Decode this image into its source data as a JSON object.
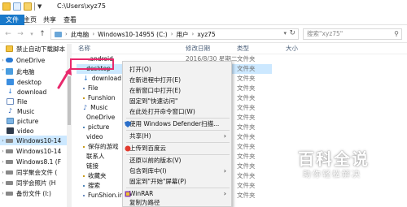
{
  "window": {
    "title": "C:\\Users\\xyz75"
  },
  "ribbon": {
    "tabs": [
      "文件",
      "主页",
      "共享",
      "查看"
    ]
  },
  "address": {
    "segments": [
      "此电脑",
      "Windows10-14955 (C:)",
      "用户",
      "xyz75"
    ],
    "search_placeholder": "搜索\"xyz75\""
  },
  "sidebar": {
    "items": [
      {
        "label": "禁止自动下载脚本",
        "icon": "folder-icon"
      },
      {
        "label": "OneDrive",
        "icon": "onedrive-icon"
      },
      {
        "label": "此电脑",
        "icon": "pc-icon"
      },
      {
        "label": "desktop",
        "icon": "desktop-icon"
      },
      {
        "label": "download",
        "icon": "download-icon"
      },
      {
        "label": "File",
        "icon": "folder-icon"
      },
      {
        "label": "Music",
        "icon": "music-icon"
      },
      {
        "label": "picture",
        "icon": "picture-icon"
      },
      {
        "label": "video",
        "icon": "video-icon"
      },
      {
        "label": "Windows10-14",
        "icon": "drive-icon"
      },
      {
        "label": "Windows10-14",
        "icon": "drive-icon"
      },
      {
        "label": "Windows8.1 (F",
        "icon": "drive-icon"
      },
      {
        "label": "同学聚会文件 (",
        "icon": "drive-icon"
      },
      {
        "label": "同学会照片 (H",
        "icon": "drive-icon"
      },
      {
        "label": "备份文件 (I:)",
        "icon": "drive-icon"
      }
    ]
  },
  "columns": {
    "name": "名称",
    "date": "修改日期",
    "type": "类型",
    "size": "大小"
  },
  "files": [
    {
      "name": ".android",
      "date": "2016/8/30 星期二",
      "type": "文件夹"
    },
    {
      "name": "desktop",
      "date": "",
      "type": "文件夹"
    },
    {
      "name": "download",
      "date": "",
      "type": "文件夹"
    },
    {
      "name": "File",
      "date": "",
      "type": "文件夹"
    },
    {
      "name": "Funshion",
      "date": "",
      "type": "文件夹"
    },
    {
      "name": "Music",
      "date": "",
      "type": "文件夹"
    },
    {
      "name": "OneDrive",
      "date": "",
      "type": "文件夹"
    },
    {
      "name": "picture",
      "date": "",
      "type": "文件夹"
    },
    {
      "name": "video",
      "date": "",
      "type": "文件夹"
    },
    {
      "name": "保存的游戏",
      "date": "",
      "type": "文件夹"
    },
    {
      "name": "联系人",
      "date": "",
      "type": "文件夹"
    },
    {
      "name": "链接",
      "date": "",
      "type": "文件夹"
    },
    {
      "name": "收藏夹",
      "date": "",
      "type": "文件夹"
    },
    {
      "name": "搜索",
      "date": "",
      "type": "文件夹"
    },
    {
      "name": "FunShion.ini",
      "date": "",
      "type": "文件夹"
    }
  ],
  "context_menu": {
    "items": [
      "打开(O)",
      "在新进程中打开(E)",
      "在新窗口中打开(E)",
      "固定到\"快速访问\"",
      "在此处打开命令窗口(W)",
      "使用 Windows Defender扫描...",
      "共享(H)",
      "上传到百度云",
      "还原以前的版本(V)",
      "包含到库中(I)",
      "固定到\"开始\"屏幕(P)",
      "WinRAR",
      "复制为路径"
    ]
  },
  "watermark": {
    "title": "百科全说",
    "subtitle": "助你轻松解决"
  },
  "colors": {
    "accent": "#1979ca",
    "selection": "#cce8ff",
    "highlight": "#e8296c"
  }
}
